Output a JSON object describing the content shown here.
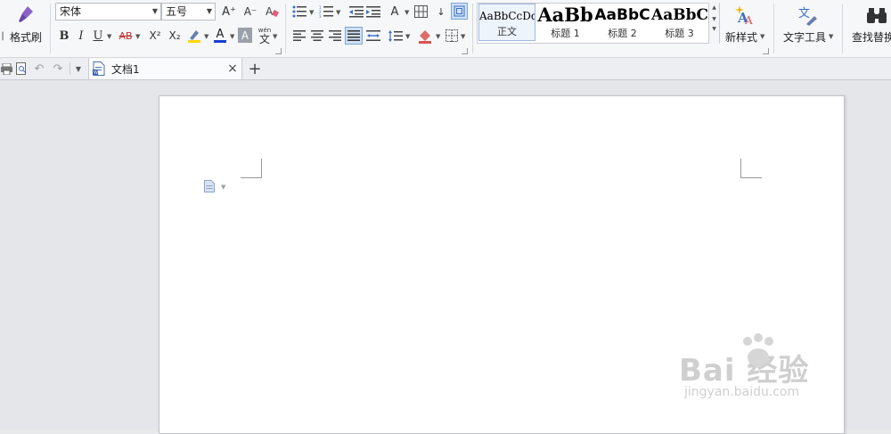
{
  "ribbon": {
    "format_painter_label": "格式刷",
    "font_name": "宋体",
    "font_size": "五号",
    "bold": "B",
    "italic": "I",
    "underline": "U",
    "strikethrough": "AB",
    "superscript": "X²",
    "subscript": "X₂",
    "font_color": "A",
    "char_shading": "A",
    "phonetic_top": "wén",
    "phonetic_bottom": "文",
    "grow_font": "A⁺",
    "shrink_font": "A⁻",
    "styles": [
      {
        "sample": "AaBbCcDd",
        "name": "正文"
      },
      {
        "sample": "AaBb",
        "name": "标题 1"
      },
      {
        "sample": "AaBbC",
        "name": "标题 2"
      },
      {
        "sample": "AaBbC",
        "name": "标题 3"
      }
    ],
    "new_style_label": "新样式",
    "text_tools_label": "文字工具",
    "find_replace_label": "查找替换"
  },
  "tabs": {
    "doc_title": "文档1",
    "close": "×",
    "new_tab": "+"
  },
  "watermark": {
    "logo": "Bai 经验",
    "url": "jingyan.baidu.com"
  },
  "colors": {
    "accent": "#3b6fc6",
    "highlight": "#ffd800",
    "font_color": "#1a3fd0"
  }
}
